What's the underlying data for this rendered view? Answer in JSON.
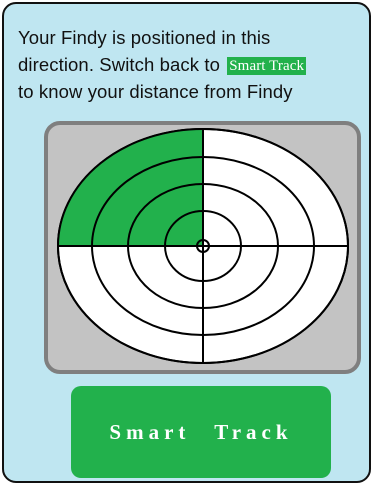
{
  "message": {
    "line1": "Your Findy is positioned in this",
    "line2_prefix": "direction. Switch back to",
    "line2_tag": "Smart Track",
    "line3": "to know your distance from Findy"
  },
  "radar": {
    "highlighted_quadrant": "top-left",
    "ring_count": 4
  },
  "button": {
    "label": "Smart   Track"
  },
  "colors": {
    "card_background": "#bfe6f1",
    "accent_green": "#22b14c",
    "radar_frame": "#c3c3c3",
    "radar_border": "#7f7f7f"
  }
}
